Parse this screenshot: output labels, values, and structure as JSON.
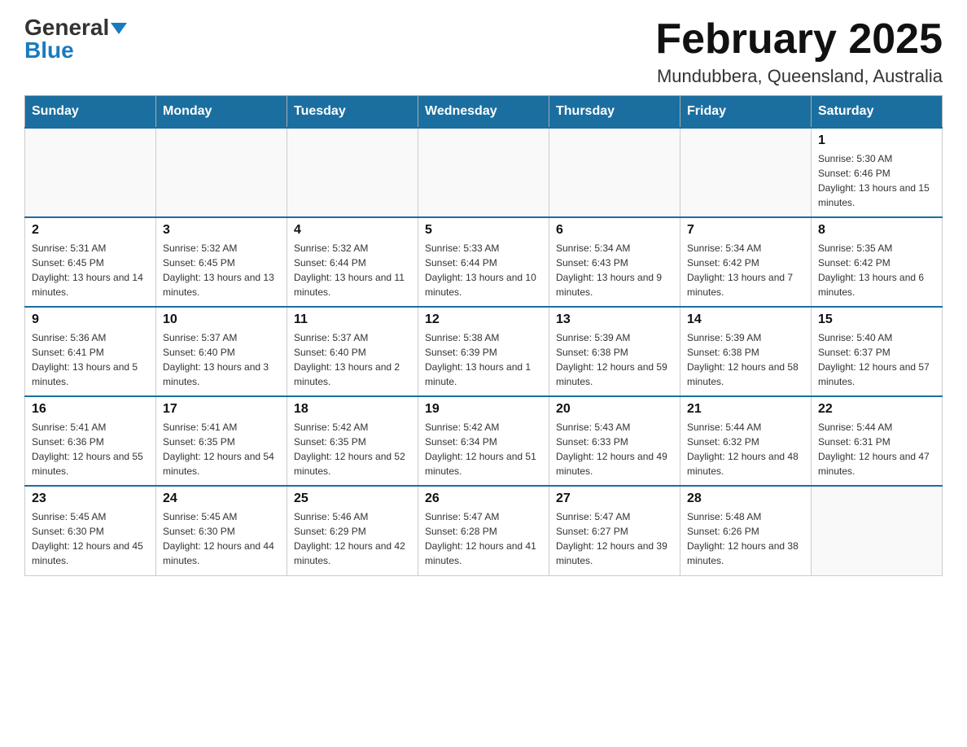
{
  "header": {
    "logo_general": "General",
    "logo_blue": "Blue",
    "month_title": "February 2025",
    "location": "Mundubbera, Queensland, Australia"
  },
  "weekdays": [
    "Sunday",
    "Monday",
    "Tuesday",
    "Wednesday",
    "Thursday",
    "Friday",
    "Saturday"
  ],
  "weeks": [
    [
      {
        "day": "",
        "info": ""
      },
      {
        "day": "",
        "info": ""
      },
      {
        "day": "",
        "info": ""
      },
      {
        "day": "",
        "info": ""
      },
      {
        "day": "",
        "info": ""
      },
      {
        "day": "",
        "info": ""
      },
      {
        "day": "1",
        "info": "Sunrise: 5:30 AM\nSunset: 6:46 PM\nDaylight: 13 hours and 15 minutes."
      }
    ],
    [
      {
        "day": "2",
        "info": "Sunrise: 5:31 AM\nSunset: 6:45 PM\nDaylight: 13 hours and 14 minutes."
      },
      {
        "day": "3",
        "info": "Sunrise: 5:32 AM\nSunset: 6:45 PM\nDaylight: 13 hours and 13 minutes."
      },
      {
        "day": "4",
        "info": "Sunrise: 5:32 AM\nSunset: 6:44 PM\nDaylight: 13 hours and 11 minutes."
      },
      {
        "day": "5",
        "info": "Sunrise: 5:33 AM\nSunset: 6:44 PM\nDaylight: 13 hours and 10 minutes."
      },
      {
        "day": "6",
        "info": "Sunrise: 5:34 AM\nSunset: 6:43 PM\nDaylight: 13 hours and 9 minutes."
      },
      {
        "day": "7",
        "info": "Sunrise: 5:34 AM\nSunset: 6:42 PM\nDaylight: 13 hours and 7 minutes."
      },
      {
        "day": "8",
        "info": "Sunrise: 5:35 AM\nSunset: 6:42 PM\nDaylight: 13 hours and 6 minutes."
      }
    ],
    [
      {
        "day": "9",
        "info": "Sunrise: 5:36 AM\nSunset: 6:41 PM\nDaylight: 13 hours and 5 minutes."
      },
      {
        "day": "10",
        "info": "Sunrise: 5:37 AM\nSunset: 6:40 PM\nDaylight: 13 hours and 3 minutes."
      },
      {
        "day": "11",
        "info": "Sunrise: 5:37 AM\nSunset: 6:40 PM\nDaylight: 13 hours and 2 minutes."
      },
      {
        "day": "12",
        "info": "Sunrise: 5:38 AM\nSunset: 6:39 PM\nDaylight: 13 hours and 1 minute."
      },
      {
        "day": "13",
        "info": "Sunrise: 5:39 AM\nSunset: 6:38 PM\nDaylight: 12 hours and 59 minutes."
      },
      {
        "day": "14",
        "info": "Sunrise: 5:39 AM\nSunset: 6:38 PM\nDaylight: 12 hours and 58 minutes."
      },
      {
        "day": "15",
        "info": "Sunrise: 5:40 AM\nSunset: 6:37 PM\nDaylight: 12 hours and 57 minutes."
      }
    ],
    [
      {
        "day": "16",
        "info": "Sunrise: 5:41 AM\nSunset: 6:36 PM\nDaylight: 12 hours and 55 minutes."
      },
      {
        "day": "17",
        "info": "Sunrise: 5:41 AM\nSunset: 6:35 PM\nDaylight: 12 hours and 54 minutes."
      },
      {
        "day": "18",
        "info": "Sunrise: 5:42 AM\nSunset: 6:35 PM\nDaylight: 12 hours and 52 minutes."
      },
      {
        "day": "19",
        "info": "Sunrise: 5:42 AM\nSunset: 6:34 PM\nDaylight: 12 hours and 51 minutes."
      },
      {
        "day": "20",
        "info": "Sunrise: 5:43 AM\nSunset: 6:33 PM\nDaylight: 12 hours and 49 minutes."
      },
      {
        "day": "21",
        "info": "Sunrise: 5:44 AM\nSunset: 6:32 PM\nDaylight: 12 hours and 48 minutes."
      },
      {
        "day": "22",
        "info": "Sunrise: 5:44 AM\nSunset: 6:31 PM\nDaylight: 12 hours and 47 minutes."
      }
    ],
    [
      {
        "day": "23",
        "info": "Sunrise: 5:45 AM\nSunset: 6:30 PM\nDaylight: 12 hours and 45 minutes."
      },
      {
        "day": "24",
        "info": "Sunrise: 5:45 AM\nSunset: 6:30 PM\nDaylight: 12 hours and 44 minutes."
      },
      {
        "day": "25",
        "info": "Sunrise: 5:46 AM\nSunset: 6:29 PM\nDaylight: 12 hours and 42 minutes."
      },
      {
        "day": "26",
        "info": "Sunrise: 5:47 AM\nSunset: 6:28 PM\nDaylight: 12 hours and 41 minutes."
      },
      {
        "day": "27",
        "info": "Sunrise: 5:47 AM\nSunset: 6:27 PM\nDaylight: 12 hours and 39 minutes."
      },
      {
        "day": "28",
        "info": "Sunrise: 5:48 AM\nSunset: 6:26 PM\nDaylight: 12 hours and 38 minutes."
      },
      {
        "day": "",
        "info": ""
      }
    ]
  ]
}
